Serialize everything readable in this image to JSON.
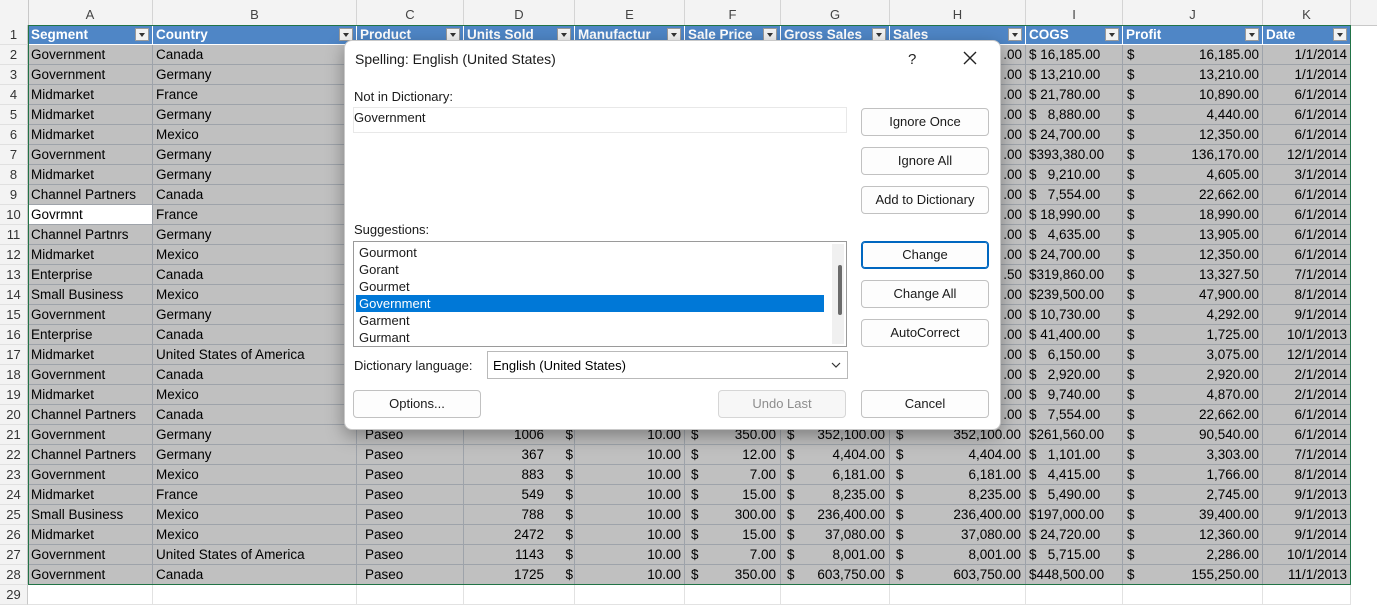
{
  "sheet": {
    "columns": [
      "A",
      "B",
      "C",
      "D",
      "E",
      "F",
      "G",
      "H",
      "I",
      "J",
      "K"
    ],
    "header_row_number": "1",
    "headers": [
      "Segment",
      "Country",
      "Product",
      "Units Sold",
      "Manufactur",
      "Sale Price",
      "Gross Sales",
      "Sales",
      "COGS",
      "Profit",
      "Date"
    ],
    "rows": [
      {
        "n": "2",
        "seg": "Government",
        "country": "Canada",
        "cogs": "$ 16,185.00",
        "profit": "16,185.00",
        "date": "1/1/2014"
      },
      {
        "n": "3",
        "seg": "Government",
        "country": "Germany",
        "cogs": "$ 13,210.00",
        "profit": "13,210.00",
        "date": "1/1/2014"
      },
      {
        "n": "4",
        "seg": "Midmarket",
        "country": "France",
        "cogs": "$ 21,780.00",
        "profit": "10,890.00",
        "date": "6/1/2014"
      },
      {
        "n": "5",
        "seg": "Midmarket",
        "country": "Germany",
        "cogs": "$   8,880.00",
        "profit": "4,440.00",
        "date": "6/1/2014"
      },
      {
        "n": "6",
        "seg": "Midmarket",
        "country": "Mexico",
        "cogs": "$ 24,700.00",
        "profit": "12,350.00",
        "date": "6/1/2014"
      },
      {
        "n": "7",
        "seg": "Government",
        "country": "Germany",
        "cogs": "$393,380.00",
        "profit": "136,170.00",
        "date": "12/1/2014"
      },
      {
        "n": "8",
        "seg": "Midmarket",
        "country": "Germany",
        "cogs": "$   9,210.00",
        "profit": "4,605.00",
        "date": "3/1/2014"
      },
      {
        "n": "9",
        "seg": "Channel Partners",
        "country": "Canada",
        "cogs": "$   7,554.00",
        "profit": "22,662.00",
        "date": "6/1/2014"
      },
      {
        "n": "10",
        "seg": "Govrmnt",
        "country": "France",
        "cogs": "$ 18,990.00",
        "profit": "18,990.00",
        "date": "6/1/2014"
      },
      {
        "n": "11",
        "seg": "Channel Partnrs",
        "country": "Germany",
        "cogs": "$   4,635.00",
        "profit": "13,905.00",
        "date": "6/1/2014"
      },
      {
        "n": "12",
        "seg": "Midmarket",
        "country": "Mexico",
        "cogs": "$ 24,700.00",
        "profit": "12,350.00",
        "date": "6/1/2014"
      },
      {
        "n": "13",
        "seg": "Enterprise",
        "country": "Canada",
        "cogs": "$319,860.00",
        "profit": "13,327.50",
        "date": "7/1/2014",
        "h": ".50"
      },
      {
        "n": "14",
        "seg": "Small Business",
        "country": "Mexico",
        "cogs": "$239,500.00",
        "profit": "47,900.00",
        "date": "8/1/2014"
      },
      {
        "n": "15",
        "seg": "Government",
        "country": "Germany",
        "cogs": "$ 10,730.00",
        "profit": "4,292.00",
        "date": "9/1/2014"
      },
      {
        "n": "16",
        "seg": "Enterprise",
        "country": "Canada",
        "cogs": "$ 41,400.00",
        "profit": "1,725.00",
        "date": "10/1/2013"
      },
      {
        "n": "17",
        "seg": "Midmarket",
        "country": "United States of America",
        "cogs": "$   6,150.00",
        "profit": "3,075.00",
        "date": "12/1/2014"
      },
      {
        "n": "18",
        "seg": "Government",
        "country": "Canada",
        "cogs": "$   2,920.00",
        "profit": "2,920.00",
        "date": "2/1/2014"
      },
      {
        "n": "19",
        "seg": "Midmarket",
        "country": "Mexico",
        "cogs": "$   9,740.00",
        "profit": "4,870.00",
        "date": "2/1/2014"
      },
      {
        "n": "20",
        "seg": "Channel Partners",
        "country": "Canada",
        "cogs": "$   7,554.00",
        "profit": "22,662.00",
        "date": "6/1/2014"
      }
    ],
    "full_rows": [
      {
        "n": "21",
        "seg": "Government",
        "country": "Germany",
        "product": "Paseo",
        "units": "1006",
        "mfg": "10.00",
        "price": "350.00",
        "gross": "352,100.00",
        "sales": "352,100.00",
        "cogs": "$261,560.00",
        "profit": "90,540.00",
        "date": "6/1/2014"
      },
      {
        "n": "22",
        "seg": "Channel Partners",
        "country": "Germany",
        "product": "Paseo",
        "units": "367",
        "mfg": "10.00",
        "price": "12.00",
        "gross": "4,404.00",
        "sales": "4,404.00",
        "cogs": "$   1,101.00",
        "profit": "3,303.00",
        "date": "7/1/2014"
      },
      {
        "n": "23",
        "seg": "Government",
        "country": "Mexico",
        "product": "Paseo",
        "units": "883",
        "mfg": "10.00",
        "price": "7.00",
        "gross": "6,181.00",
        "sales": "6,181.00",
        "cogs": "$   4,415.00",
        "profit": "1,766.00",
        "date": "8/1/2014"
      },
      {
        "n": "24",
        "seg": "Midmarket",
        "country": "France",
        "product": "Paseo",
        "units": "549",
        "mfg": "10.00",
        "price": "15.00",
        "gross": "8,235.00",
        "sales": "8,235.00",
        "cogs": "$   5,490.00",
        "profit": "2,745.00",
        "date": "9/1/2013"
      },
      {
        "n": "25",
        "seg": "Small Business",
        "country": "Mexico",
        "product": "Paseo",
        "units": "788",
        "mfg": "10.00",
        "price": "300.00",
        "gross": "236,400.00",
        "sales": "236,400.00",
        "cogs": "$197,000.00",
        "profit": "39,400.00",
        "date": "9/1/2013"
      },
      {
        "n": "26",
        "seg": "Midmarket",
        "country": "Mexico",
        "product": "Paseo",
        "units": "2472",
        "mfg": "10.00",
        "price": "15.00",
        "gross": "37,080.00",
        "sales": "37,080.00",
        "cogs": "$ 24,720.00",
        "profit": "12,360.00",
        "date": "9/1/2014"
      },
      {
        "n": "27",
        "seg": "Government",
        "country": "United States of America",
        "product": "Paseo",
        "units": "1143",
        "mfg": "10.00",
        "price": "7.00",
        "gross": "8,001.00",
        "sales": "8,001.00",
        "cogs": "$   5,715.00",
        "profit": "2,286.00",
        "date": "10/1/2014"
      },
      {
        "n": "28",
        "seg": "Government",
        "country": "Canada",
        "product": "Paseo",
        "units": "1725",
        "mfg": "10.00",
        "price": "350.00",
        "gross": "603,750.00",
        "sales": "603,750.00",
        "cogs": "$448,500.00",
        "profit": "155,250.00",
        "date": "11/1/2013"
      }
    ],
    "empty_row_number": "29",
    "currency": "$",
    "sales_tail": ".00"
  },
  "dialog": {
    "title": "Spelling: English (United States)",
    "help": "?",
    "not_in_dictionary_label": "Not in Dictionary:",
    "not_in_dictionary_value": "Government",
    "suggestions_label": "Suggestions:",
    "suggestions": [
      "Gourmont",
      "Gorant",
      "Gourmet",
      "Government",
      "Garment",
      "Gurmant"
    ],
    "selected_suggestion": "Government",
    "dictionary_language_label": "Dictionary language:",
    "dictionary_language": "English (United States)",
    "buttons": {
      "ignore_once": "Ignore Once",
      "ignore_all": "Ignore All",
      "add_to_dictionary": "Add to Dictionary",
      "change": "Change",
      "change_all": "Change All",
      "autocorrect": "AutoCorrect",
      "options": "Options...",
      "undo_last": "Undo Last",
      "cancel": "Cancel"
    }
  },
  "colors": {
    "header_blue": "#4f86c6",
    "selection_blue": "#0078d7",
    "dim_cell": "#c0c0c0"
  }
}
